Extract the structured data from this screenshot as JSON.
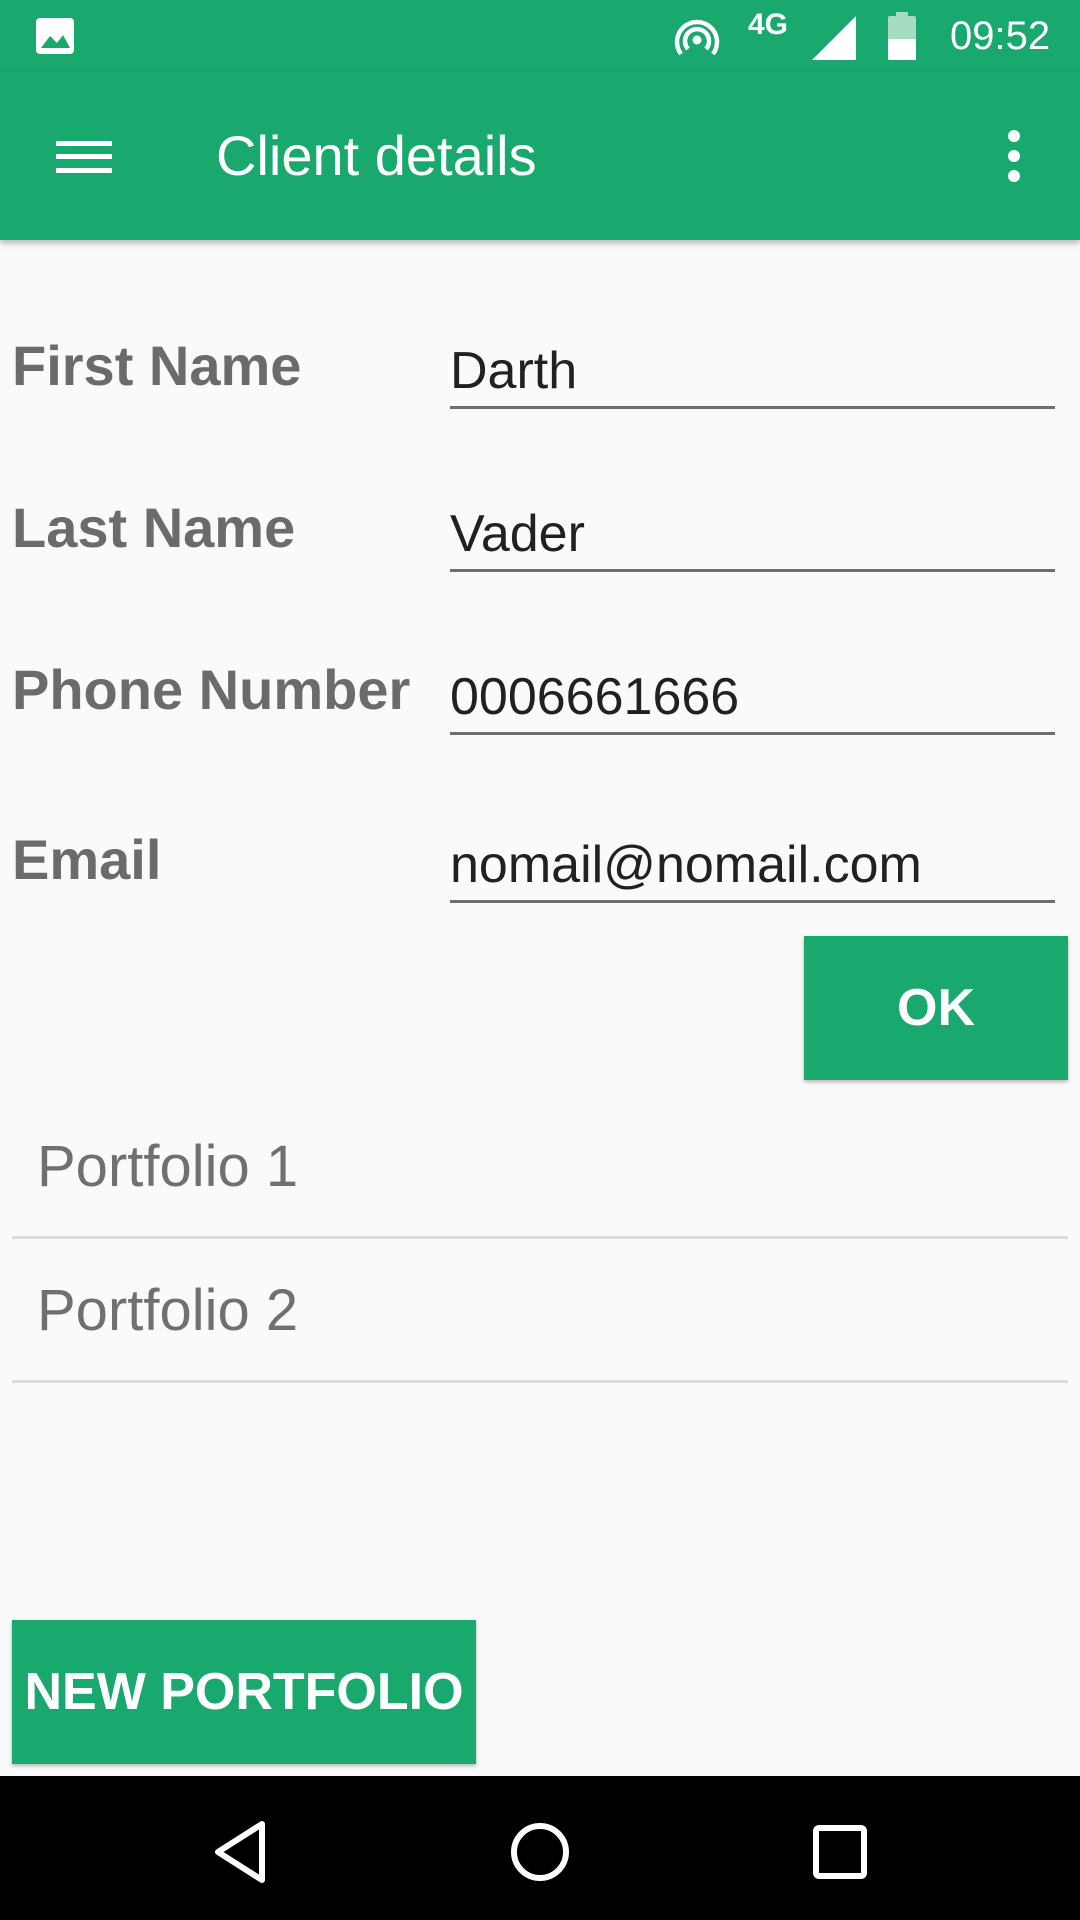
{
  "status_bar": {
    "time": "09:52",
    "network": "4G",
    "icons": [
      "image-notification-icon",
      "hotspot-icon",
      "signal-icon",
      "battery-icon"
    ]
  },
  "app_bar": {
    "title": "Client details",
    "icons": [
      "hamburger-menu-icon",
      "more-vertical-icon"
    ]
  },
  "form": {
    "first_name": {
      "label": "First Name",
      "value": "Darth"
    },
    "last_name": {
      "label": "Last Name",
      "value": "Vader"
    },
    "phone": {
      "label": "Phone Number",
      "value": "0006661666"
    },
    "email": {
      "label": "Email",
      "value": "nomail@nomail.com"
    },
    "ok_label": "OK"
  },
  "portfolios": [
    "Portfolio 1",
    "Portfolio 2"
  ],
  "new_portfolio_label": "NEW PORTFOLIO",
  "nav_bar": {
    "icons": [
      "back-triangle-icon",
      "home-circle-icon",
      "recents-square-icon"
    ]
  },
  "colors": {
    "primary": "#19a86d",
    "label_gray": "#6b6b6b",
    "background": "#fafafa"
  }
}
